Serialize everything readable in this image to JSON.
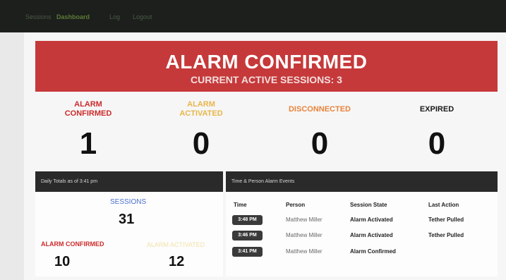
{
  "nav": {
    "items": [
      {
        "label": "Sessions",
        "active": false
      },
      {
        "label": "Dashboard",
        "active": true
      },
      {
        "label": "Log",
        "active": false
      },
      {
        "label": "Logout",
        "active": false
      }
    ]
  },
  "banner": {
    "title": "ALARM CONFIRMED",
    "subtitle": "CURRENT ACTIVE SESSIONS: 3",
    "color": "#c6393a"
  },
  "stats": [
    {
      "label_line1": "ALARM",
      "label_line2": "CONFIRMED",
      "value": "1",
      "color": "#cc2b2b"
    },
    {
      "label_line1": "ALARM",
      "label_line2": "ACTIVATED",
      "value": "0",
      "color": "#e9b54a"
    },
    {
      "label_line1": "DISCONNECTED",
      "label_line2": "",
      "value": "0",
      "color": "#e8843c"
    },
    {
      "label_line1": "EXPIRED",
      "label_line2": "",
      "value": "0",
      "color": "#1a1a1a"
    }
  ],
  "daily_panel": {
    "header": "Daily Totals as of 3:41 pm",
    "sessions_label": "SESSIONS",
    "sessions_value": "31",
    "confirmed_label": "ALARM CONFIRMED",
    "confirmed_value": "10",
    "activated_label": "ALARM ACTIVATED",
    "activated_value": "12"
  },
  "events_panel": {
    "header": "Time & Person Alarm Events",
    "columns": [
      "Time",
      "Person",
      "Session State",
      "Last Action"
    ],
    "rows": [
      {
        "time": "3:48 PM",
        "person": "Matthew Miller",
        "state": "Alarm Activated",
        "action": "Tether Pulled"
      },
      {
        "time": "3:46 PM",
        "person": "Matthew Miller",
        "state": "Alarm Activated",
        "action": "Tether Pulled"
      },
      {
        "time": "3:41 PM",
        "person": "Matthew Miller",
        "state": "Alarm Confirmed",
        "action": ""
      }
    ]
  }
}
